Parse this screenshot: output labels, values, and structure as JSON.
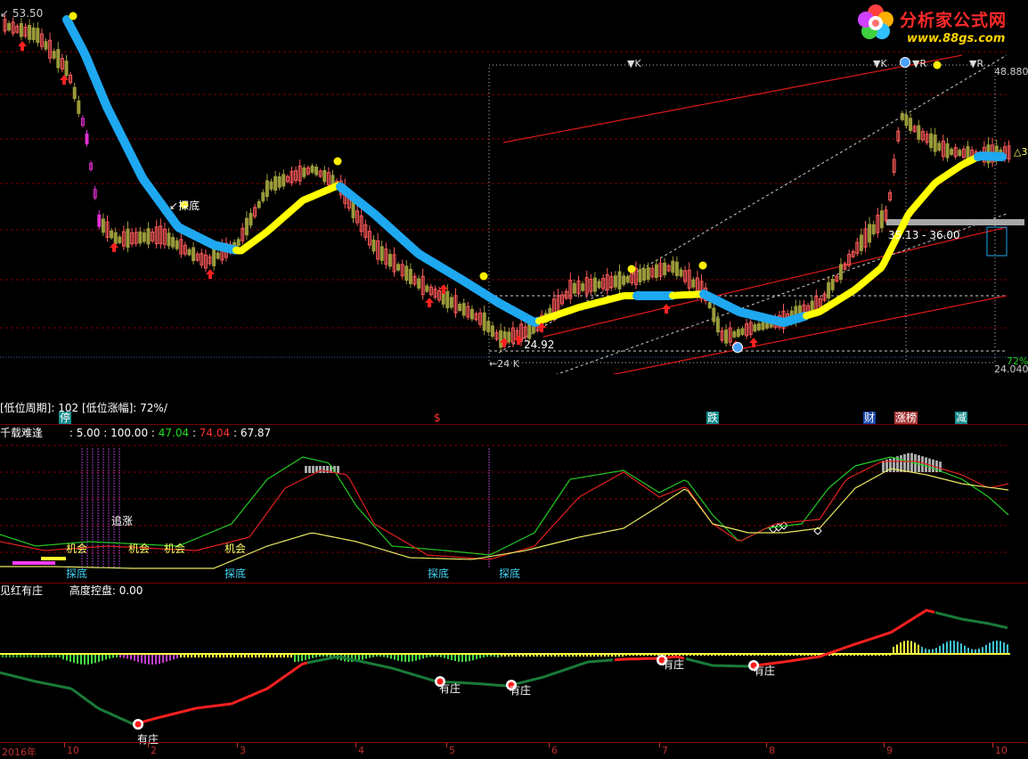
{
  "logo": {
    "title": "分析家公式网",
    "url": "www.88gs.com"
  },
  "main": {
    "price_high": "53.50",
    "label_24_92": "24.92",
    "label_24_k": "24 K",
    "label_tandi": "探底",
    "label_range": "35.13 - 36.00",
    "label_48880": "48.880",
    "label_24040": "24.040",
    "label_72": "72%",
    "label_k1": "▼K",
    "label_k2": "▼K",
    "label_r1": "▼R",
    "label_r2": "▼R",
    "label_3": "3"
  },
  "info_line": {
    "text": "[低位周期]: 102 [低位涨幅]: 72%/"
  },
  "events": [
    {
      "text": "停",
      "color": "#ffffff",
      "bg": "#138a8a"
    },
    {
      "text": "$",
      "color": "#ff3030",
      "bg": ""
    },
    {
      "text": "跌",
      "color": "#ffffff",
      "bg": "#138a8a"
    },
    {
      "text": "财",
      "color": "#ffffff",
      "bg": "#1848a8"
    },
    {
      "text": "涨榜",
      "color": "#ffffff",
      "bg": "#a83838"
    },
    {
      "text": "减",
      "color": "#ffffff",
      "bg": "#138a8a"
    }
  ],
  "osc_header": {
    "name": "千载难逢",
    "params": ": 5.00 : 100.00 :",
    "v1": "47.04",
    "v1_color": "#22dd22",
    "v2": "74.04",
    "v2_color": "#ff3030",
    "v3": "67.87",
    "v3_color": "#ffffff"
  },
  "osc_labels": {
    "zhuizhang": "追涨",
    "jihui1": "机会",
    "jihui2": "机会",
    "jihui3": "机会",
    "jihui4": "机会",
    "tandi1": "探底",
    "tandi2": "探底",
    "tandi3": "探底",
    "tandi4": "探底"
  },
  "bot_header": {
    "name": "见红有庄",
    "label": "高度控盘:",
    "value": "0.00"
  },
  "bot_labels": {
    "z1": "有庄",
    "z2": "有庄",
    "z3": "有庄",
    "z4": "有庄",
    "z5": "有庄"
  },
  "x_axis": [
    "2016年",
    "10",
    "2",
    "3",
    "4",
    "5",
    "6",
    "7",
    "8",
    "9",
    "10"
  ],
  "colors": {
    "up": "#ff5a5a",
    "down": "#9a9a3a",
    "ma_up": "#ffff00",
    "ma_down": "#1ea8f0",
    "grid": "#7a0000"
  }
}
